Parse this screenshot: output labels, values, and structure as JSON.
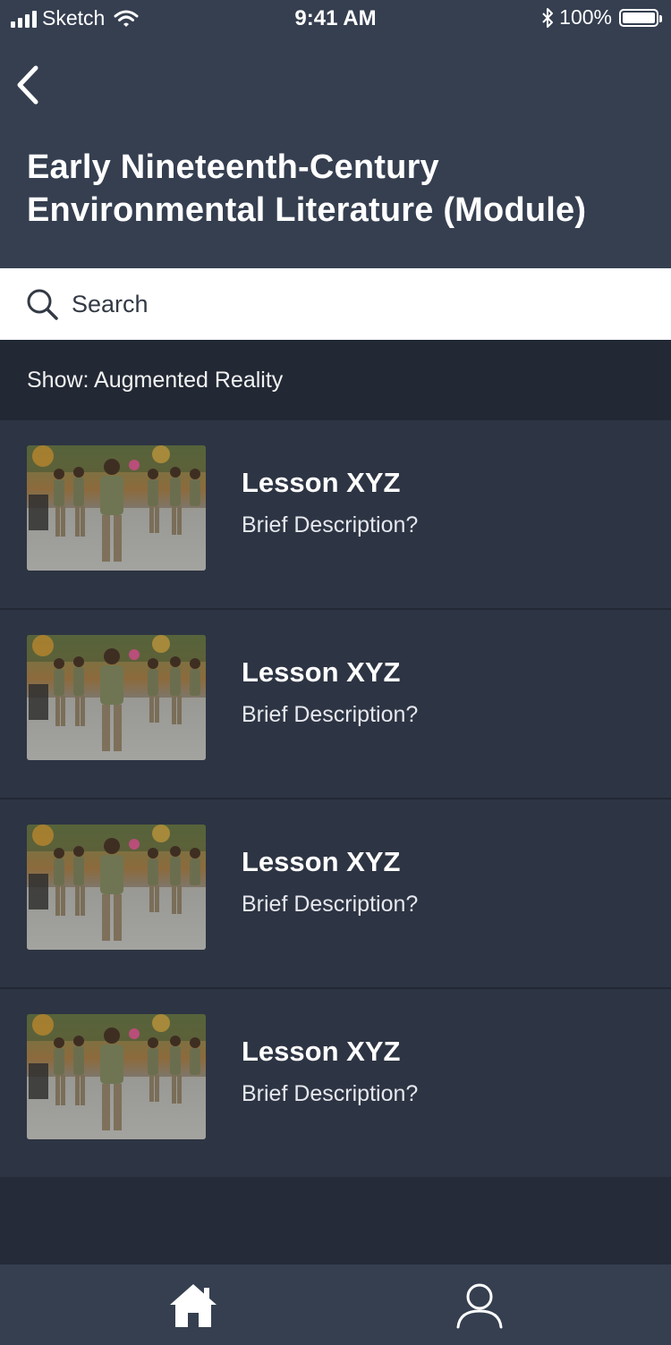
{
  "status_bar": {
    "carrier": "Sketch",
    "time": "9:41 AM",
    "battery": "100%",
    "icons": [
      "signal-icon",
      "wifi-icon",
      "bluetooth-icon",
      "battery-icon"
    ]
  },
  "header": {
    "back_icon": "chevron-left-icon",
    "title": "Early Nineteenth-Century Environmental Literature (Module)"
  },
  "search": {
    "icon": "search-icon",
    "placeholder": "Search"
  },
  "filter": {
    "label": "Show: Augmented Reality"
  },
  "lessons": [
    {
      "title": "Lesson XYZ",
      "description": "Brief Description?",
      "thumbnail": "lesson-photo-crowd"
    },
    {
      "title": "Lesson XYZ",
      "description": "Brief Description?",
      "thumbnail": "lesson-photo-crowd"
    },
    {
      "title": "Lesson XYZ",
      "description": "Brief Description?",
      "thumbnail": "lesson-photo-crowd"
    },
    {
      "title": "Lesson XYZ",
      "description": "Brief Description?",
      "thumbnail": "lesson-photo-crowd"
    }
  ],
  "tab_bar": {
    "tabs": [
      {
        "icon": "home-icon"
      },
      {
        "icon": "profile-icon"
      }
    ]
  },
  "colors": {
    "header_bg": "#353f50",
    "list_bg": "#2d3443",
    "filter_bg": "#222834",
    "text": "#ffffff"
  }
}
